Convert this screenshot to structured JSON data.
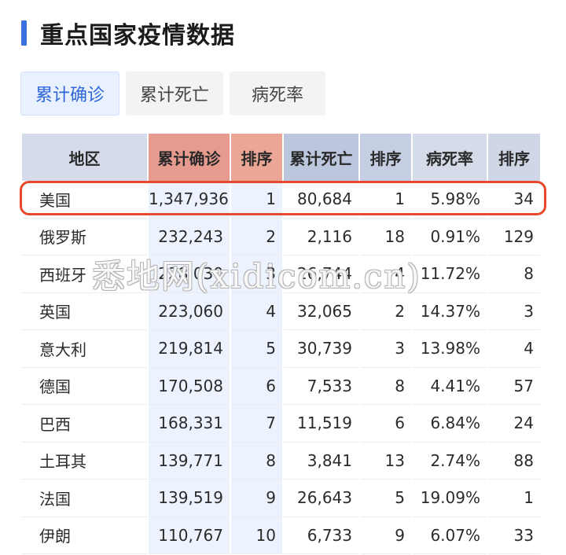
{
  "page_title": "重点国家疫情数据",
  "tabs": [
    "累计确诊",
    "累计死亡",
    "病死率"
  ],
  "active_tab": 0,
  "table": {
    "headers": [
      "地区",
      "累计确诊",
      "排序",
      "累计死亡",
      "排序",
      "病死率",
      "排序"
    ],
    "rows": [
      [
        "美国",
        "1,347,936",
        "1",
        "80,684",
        "1",
        "5.98%",
        "34"
      ],
      [
        "俄罗斯",
        "232,243",
        "2",
        "2,116",
        "18",
        "0.91%",
        "129"
      ],
      [
        "西班牙",
        "228,030",
        "3",
        "26,744",
        "4",
        "11.72%",
        "8"
      ],
      [
        "英国",
        "223,060",
        "4",
        "32,065",
        "2",
        "14.37%",
        "3"
      ],
      [
        "意大利",
        "219,814",
        "5",
        "30,739",
        "3",
        "13.98%",
        "4"
      ],
      [
        "德国",
        "170,508",
        "6",
        "7,533",
        "8",
        "4.41%",
        "57"
      ],
      [
        "巴西",
        "168,331",
        "7",
        "11,519",
        "6",
        "6.84%",
        "24"
      ],
      [
        "土耳其",
        "139,771",
        "8",
        "3,841",
        "13",
        "2.74%",
        "88"
      ],
      [
        "法国",
        "139,519",
        "9",
        "26,643",
        "5",
        "19.09%",
        "1"
      ],
      [
        "伊朗",
        "110,767",
        "10",
        "6,733",
        "9",
        "6.07%",
        "33"
      ]
    ],
    "highlighted_row": 0
  },
  "watermark": "悉地网(xidicom.cn)",
  "colors": {
    "accent": "#3a6fe0",
    "confirmed_header": "#e79b8e",
    "death_header": "#bcc6dd",
    "highlight_border": "#e8492e",
    "confirmed_column": "#edf3fe"
  }
}
